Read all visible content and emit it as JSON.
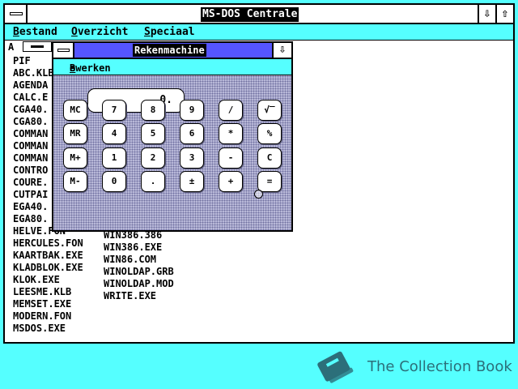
{
  "window": {
    "title": "MS-DOS Centrale",
    "minimize_icon": "arrow-down-icon",
    "maximize_icon": "arrow-up-icon"
  },
  "menubar": [
    {
      "ul": "B",
      "rest": "estand"
    },
    {
      "ul": "O",
      "rest": "verzicht"
    },
    {
      "ul": "S",
      "rest": "peciaal"
    }
  ],
  "drive": {
    "letter": "A"
  },
  "files_col1": [
    "PIF",
    "ABC.KLB",
    "AGENDA",
    "CALC.E",
    "CGA40.",
    "CGA80.",
    "COMMAN",
    "COMMAN",
    "COMMAN",
    "CONTRO",
    "COURE.",
    "CUTPAI",
    "EGA40.",
    "EGA80.",
    "HELVE.FON",
    "HERCULES.FON",
    "KAARTBAK.EXE",
    "KLADBLOK.EXE",
    "KLOK.EXE",
    "LEESME.KLB",
    "MEMSET.EXE",
    "MODERN.FON",
    "MSDOS.EXE"
  ],
  "files_col2": [
    "WIN386.386",
    "WIN386.EXE",
    "WIN86.COM",
    "WINOLDAP.GRB",
    "WINOLDAP.MOD",
    "WRITE.EXE"
  ],
  "calculator": {
    "title": "Rekenmachine",
    "menu": {
      "ul": "B",
      "rest": "ewerken"
    },
    "display": "0.",
    "keys": [
      [
        "MC",
        "7",
        "8",
        "9",
        "/",
        "√‾"
      ],
      [
        "MR",
        "4",
        "5",
        "6",
        "*",
        "%"
      ],
      [
        "M+",
        "1",
        "2",
        "3",
        "-",
        "C"
      ],
      [
        "M-",
        "0",
        ".",
        "±",
        "+",
        "="
      ]
    ]
  },
  "watermark": {
    "text": "The Collection Book",
    "icon": "book-icon",
    "color": "#2c6f7a"
  }
}
